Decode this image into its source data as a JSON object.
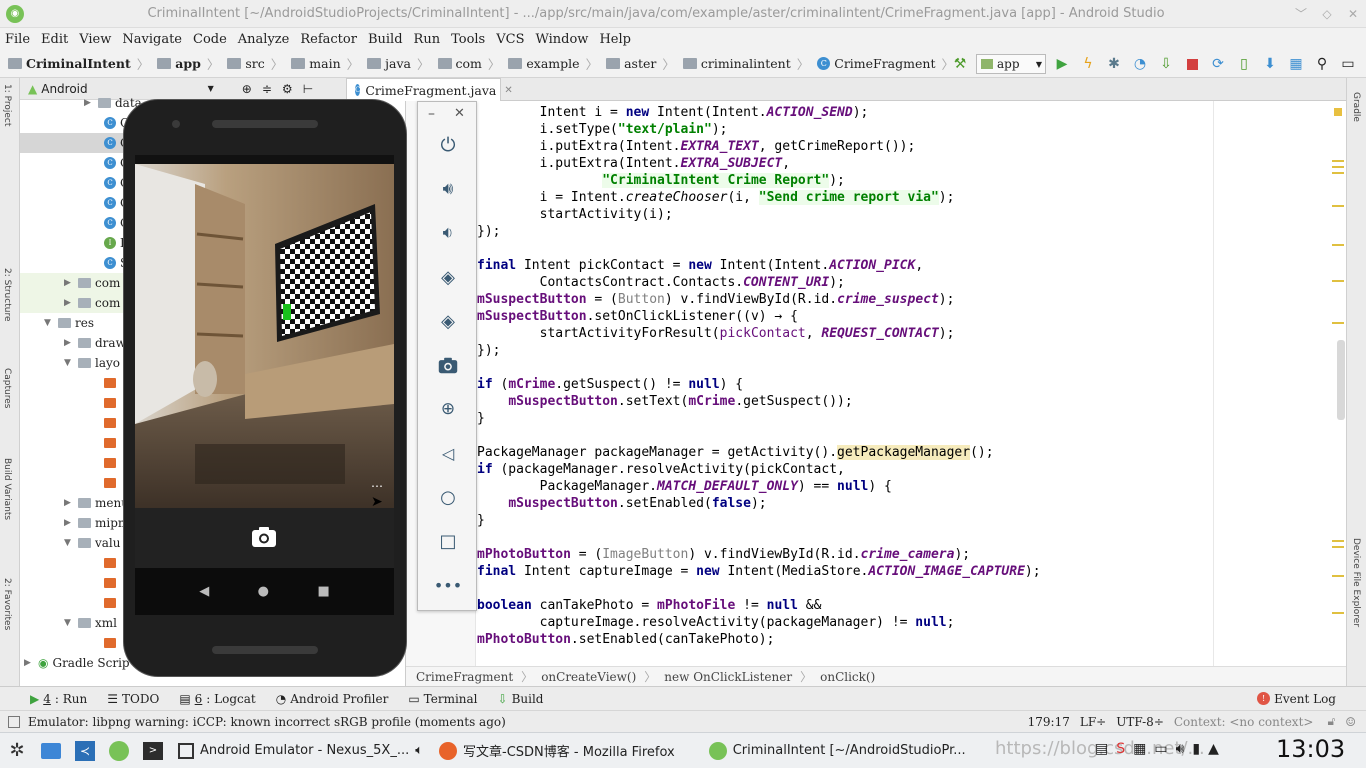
{
  "window": {
    "title": "CriminalIntent [~/AndroidStudioProjects/CriminalIntent] - .../app/src/main/java/com/example/aster/criminalintent/CrimeFragment.java [app] - Android Studio"
  },
  "menu": [
    "File",
    "Edit",
    "View",
    "Navigate",
    "Code",
    "Analyze",
    "Refactor",
    "Build",
    "Run",
    "Tools",
    "VCS",
    "Window",
    "Help"
  ],
  "nav_crumbs": [
    "CriminalIntent",
    "app",
    "src",
    "main",
    "java",
    "com",
    "example",
    "aster",
    "criminalintent",
    "CrimeFragment"
  ],
  "toolbar": {
    "run_config": "app"
  },
  "project": {
    "view_label": "Android",
    "rows": [
      {
        "label": "data"
      },
      {
        "label": "C"
      },
      {
        "label": "C"
      },
      {
        "label": "C"
      },
      {
        "label": "C"
      },
      {
        "label": "C"
      },
      {
        "label": "C"
      },
      {
        "label": "I"
      },
      {
        "label": "S"
      },
      {
        "label": "com"
      },
      {
        "label": "com"
      },
      {
        "label": "res"
      },
      {
        "label": "draw"
      },
      {
        "label": "layo"
      },
      {
        "label": ""
      },
      {
        "label": ""
      },
      {
        "label": ""
      },
      {
        "label": ""
      },
      {
        "label": ""
      },
      {
        "label": ""
      },
      {
        "label": "menu"
      },
      {
        "label": "mipm"
      },
      {
        "label": "valu"
      },
      {
        "label": ""
      },
      {
        "label": ""
      },
      {
        "label": ""
      },
      {
        "label": ""
      },
      {
        "label": "xml"
      },
      {
        "label": ""
      },
      {
        "label": "Gradle Scrip"
      }
    ]
  },
  "editor": {
    "tab": "CrimeFragment.java",
    "bottom_breadcrumb": [
      "CrimeFragment",
      "onCreateView()",
      "new OnClickListener",
      "onClick()"
    ]
  },
  "bottom_tabs": [
    {
      "num": "4",
      "label": ": Run"
    },
    {
      "num": "",
      "label": "TODO"
    },
    {
      "num": "6",
      "label": ": Logcat"
    },
    {
      "num": "",
      "label": "Android Profiler"
    },
    {
      "num": "",
      "label": "Terminal"
    },
    {
      "num": "",
      "label": "Build"
    }
  ],
  "event_log": "Event Log",
  "status": {
    "message": "Emulator: libpng warning: iCCP: known incorrect sRGB profile (moments ago)",
    "position": "179:17",
    "line_sep": "LF÷",
    "encoding": "UTF-8÷",
    "context": "Context: <no context>"
  },
  "taskbar": {
    "tasks": [
      "Android Emulator - Nexus_5X_...",
      "写文章-CSDN博客 - Mozilla Firefox",
      "CriminalIntent [~/AndroidStudioPr..."
    ],
    "clock": "13:03",
    "watermark": "https://blog.csdn.net/..."
  },
  "left_strip": [
    "1: Project",
    "2: Structure",
    "Captures",
    "Build Variants",
    "2: Favorites"
  ],
  "right_strip": [
    "Gradle",
    "Device File Explorer"
  ],
  "colors": {
    "keyword": "#000080",
    "string": "#008000",
    "field": "#660e7a",
    "accent": "#3d8fd1"
  }
}
